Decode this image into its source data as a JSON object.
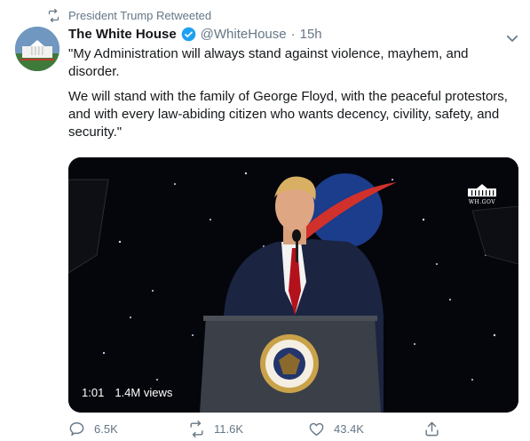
{
  "retweet_context": {
    "text": "President Trump Retweeted",
    "icon": "retweet-icon"
  },
  "author": {
    "name": "The White House",
    "verified": true,
    "handle": "@WhiteHouse",
    "separator": "·",
    "time": "15h"
  },
  "tweet": {
    "paragraph1": "\"My Administration will always stand against violence, mayhem, and disorder.",
    "paragraph2": "We will stand with the family of George Floyd, with the peaceful protestors, and with every law-abiding citizen who wants decency, civility, safety, and security.\""
  },
  "media": {
    "duration": "1:01",
    "views": "1.4M views",
    "watermark": "WH.GOV"
  },
  "actions": {
    "replies": "6.5K",
    "retweets": "11.6K",
    "likes": "43.4K"
  },
  "colors": {
    "text_primary": "#14171a",
    "text_secondary": "#657786",
    "verified_blue": "#1da1f2"
  }
}
